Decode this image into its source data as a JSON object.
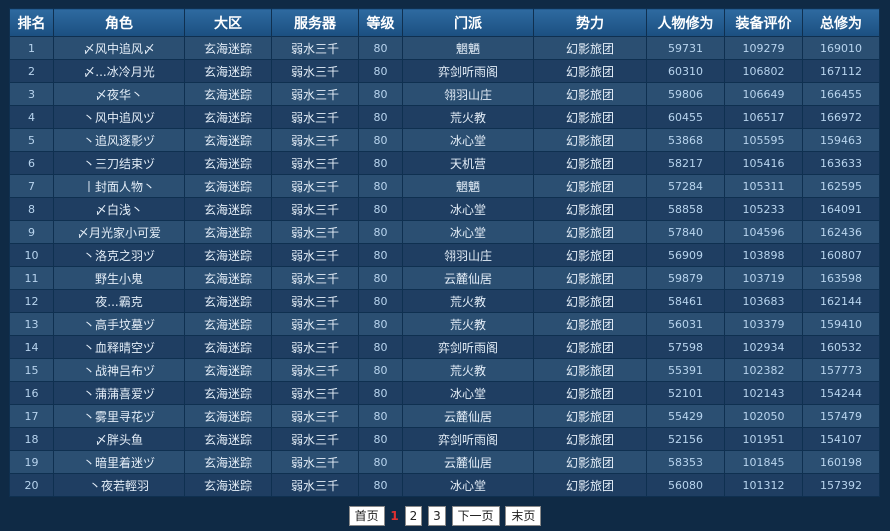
{
  "columns": [
    "排名",
    "角色",
    "大区",
    "服务器",
    "等级",
    "门派",
    "势力",
    "人物修为",
    "装备评价",
    "总修为"
  ],
  "rows": [
    [
      "1",
      "〆风中追风〆",
      "玄海迷踪",
      "弱水三千",
      "80",
      "魍魉",
      "幻影旅团",
      "59731",
      "109279",
      "169010"
    ],
    [
      "2",
      "〆...冰冷月光",
      "玄海迷踪",
      "弱水三千",
      "80",
      "弈剑听雨阁",
      "幻影旅团",
      "60310",
      "106802",
      "167112"
    ],
    [
      "3",
      "〆夜华丶",
      "玄海迷踪",
      "弱水三千",
      "80",
      "翎羽山庄",
      "幻影旅团",
      "59806",
      "106649",
      "166455"
    ],
    [
      "4",
      "丶风中追风ヅ",
      "玄海迷踪",
      "弱水三千",
      "80",
      "荒火教",
      "幻影旅团",
      "60455",
      "106517",
      "166972"
    ],
    [
      "5",
      "丶追风逐影ヅ",
      "玄海迷踪",
      "弱水三千",
      "80",
      "冰心堂",
      "幻影旅团",
      "53868",
      "105595",
      "159463"
    ],
    [
      "6",
      "丶三刀结束ヅ",
      "玄海迷踪",
      "弱水三千",
      "80",
      "天机营",
      "幻影旅团",
      "58217",
      "105416",
      "163633"
    ],
    [
      "7",
      "丨封面人物丶",
      "玄海迷踪",
      "弱水三千",
      "80",
      "魍魉",
      "幻影旅团",
      "57284",
      "105311",
      "162595"
    ],
    [
      "8",
      "〆白浅丶",
      "玄海迷踪",
      "弱水三千",
      "80",
      "冰心堂",
      "幻影旅团",
      "58858",
      "105233",
      "164091"
    ],
    [
      "9",
      "〆月光家小可爱",
      "玄海迷踪",
      "弱水三千",
      "80",
      "冰心堂",
      "幻影旅团",
      "57840",
      "104596",
      "162436"
    ],
    [
      "10",
      "丶洛克之羽ヅ",
      "玄海迷踪",
      "弱水三千",
      "80",
      "翎羽山庄",
      "幻影旅团",
      "56909",
      "103898",
      "160807"
    ],
    [
      "11",
      "野生小鬼",
      "玄海迷踪",
      "弱水三千",
      "80",
      "云麓仙居",
      "幻影旅团",
      "59879",
      "103719",
      "163598"
    ],
    [
      "12",
      "夜...霸克",
      "玄海迷踪",
      "弱水三千",
      "80",
      "荒火教",
      "幻影旅团",
      "58461",
      "103683",
      "162144"
    ],
    [
      "13",
      "丶高手坟墓ヅ",
      "玄海迷踪",
      "弱水三千",
      "80",
      "荒火教",
      "幻影旅团",
      "56031",
      "103379",
      "159410"
    ],
    [
      "14",
      "丶血释晴空ヅ",
      "玄海迷踪",
      "弱水三千",
      "80",
      "弈剑听雨阁",
      "幻影旅团",
      "57598",
      "102934",
      "160532"
    ],
    [
      "15",
      "丶战神吕布ヅ",
      "玄海迷踪",
      "弱水三千",
      "80",
      "荒火教",
      "幻影旅团",
      "55391",
      "102382",
      "157773"
    ],
    [
      "16",
      "丶蒲蒲喜爱ヅ",
      "玄海迷踪",
      "弱水三千",
      "80",
      "冰心堂",
      "幻影旅团",
      "52101",
      "102143",
      "154244"
    ],
    [
      "17",
      "丶雾里寻花ヅ",
      "玄海迷踪",
      "弱水三千",
      "80",
      "云麓仙居",
      "幻影旅团",
      "55429",
      "102050",
      "157479"
    ],
    [
      "18",
      "〆胖头鱼",
      "玄海迷踪",
      "弱水三千",
      "80",
      "弈剑听雨阁",
      "幻影旅团",
      "52156",
      "101951",
      "154107"
    ],
    [
      "19",
      "丶暗里着迷ヅ",
      "玄海迷踪",
      "弱水三千",
      "80",
      "云麓仙居",
      "幻影旅团",
      "58353",
      "101845",
      "160198"
    ],
    [
      "20",
      "丶夜若輕羽",
      "玄海迷踪",
      "弱水三千",
      "80",
      "冰心堂",
      "幻影旅团",
      "56080",
      "101312",
      "157392"
    ]
  ],
  "pagination": {
    "first": "首页",
    "current": "1",
    "pages": [
      "2",
      "3"
    ],
    "next": "下一页",
    "last": "末页"
  },
  "colors": {
    "page_background": "#0f2a45",
    "header_background": "#2a6399",
    "row_odd": "#2b4f72",
    "row_even": "#1f3e62",
    "current_page": "#e03030"
  }
}
